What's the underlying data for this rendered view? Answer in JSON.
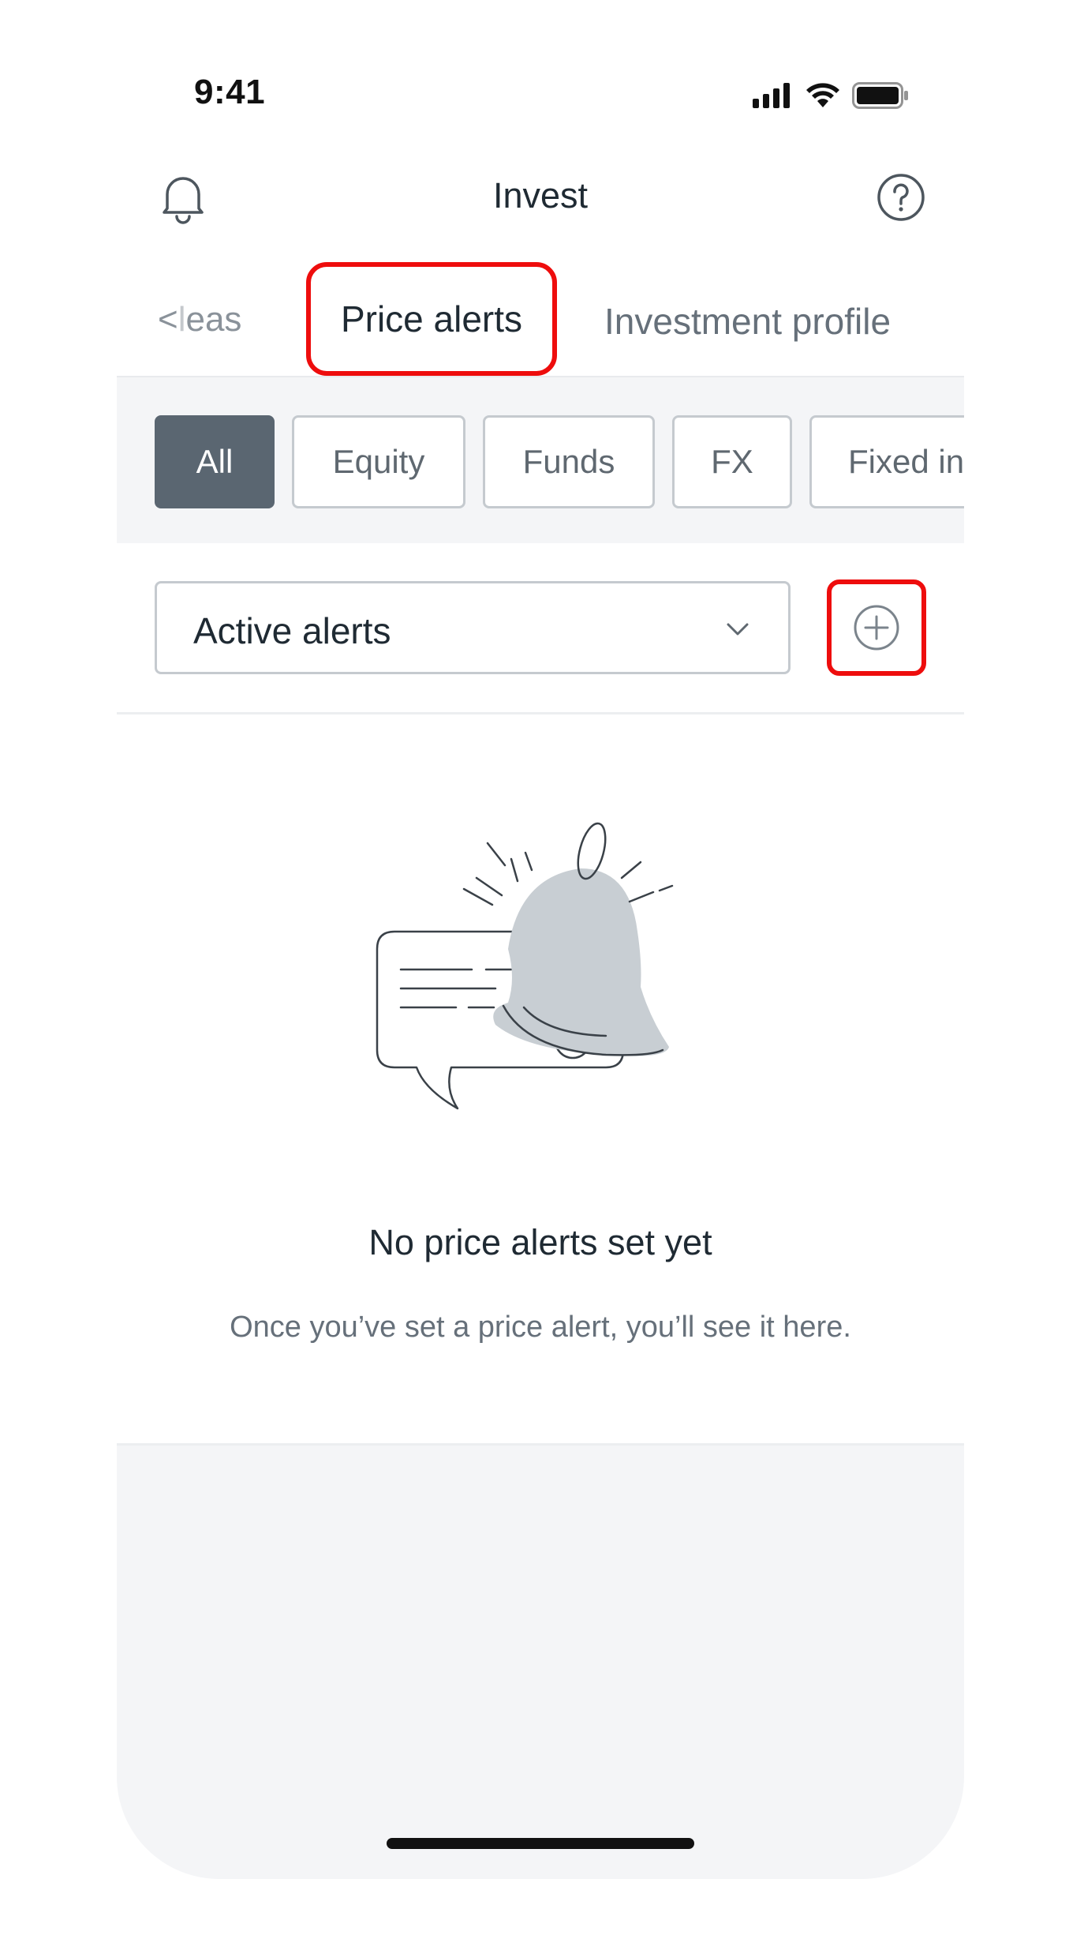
{
  "status_bar": {
    "time": "9:41"
  },
  "header": {
    "title": "Invest"
  },
  "tabs": {
    "previous_fragment": "Ideas",
    "previous_visible_start": "<",
    "previous_faded": "l",
    "previous_text": "eas",
    "active": "Price alerts",
    "next": "Investment profile"
  },
  "filters": [
    "All",
    "Equity",
    "Funds",
    "FX",
    "Fixed in"
  ],
  "alerts_select": {
    "value": "Active alerts"
  },
  "empty_state": {
    "title": "No price alerts set yet",
    "subtitle": "Once you’ve set a price alert, you’ll see it here."
  },
  "colors": {
    "accent_highlight": "#ee0d0d",
    "chip_selected": "#5a6671",
    "bell_fill": "#c8ced3"
  }
}
